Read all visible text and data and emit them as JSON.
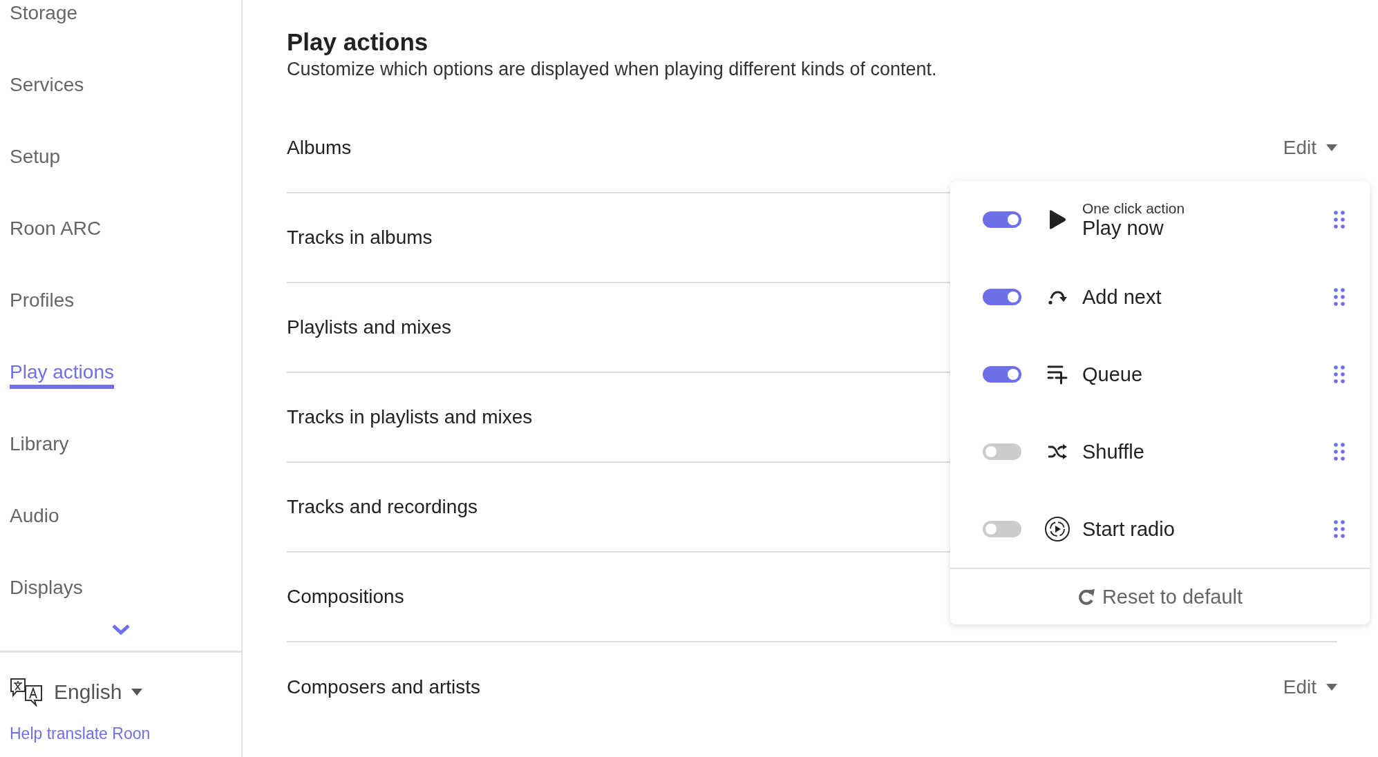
{
  "sidebar": {
    "items": [
      {
        "label": "Storage",
        "selected": false
      },
      {
        "label": "Services",
        "selected": false
      },
      {
        "label": "Setup",
        "selected": false
      },
      {
        "label": "Roon ARC",
        "selected": false
      },
      {
        "label": "Profiles",
        "selected": false
      },
      {
        "label": "Play actions",
        "selected": true
      },
      {
        "label": "Library",
        "selected": false
      },
      {
        "label": "Audio",
        "selected": false
      },
      {
        "label": "Displays",
        "selected": false
      }
    ],
    "language": "English",
    "help_link": "Help translate Roon"
  },
  "main": {
    "title": "Play actions",
    "subtitle": "Customize which options are displayed when playing different kinds of content.",
    "rows": [
      {
        "label": "Albums",
        "edit": "Edit"
      },
      {
        "label": "Tracks in albums"
      },
      {
        "label": "Playlists and mixes"
      },
      {
        "label": "Tracks in playlists and mixes"
      },
      {
        "label": "Tracks and recordings"
      },
      {
        "label": "Compositions"
      },
      {
        "label": "Composers and artists",
        "edit": "Edit"
      }
    ]
  },
  "popup": {
    "actions": [
      {
        "kind": "play",
        "caption": "One click action",
        "label": "Play now",
        "on": true
      },
      {
        "kind": "add_next",
        "label": "Add next",
        "on": true
      },
      {
        "kind": "queue",
        "label": "Queue",
        "on": true
      },
      {
        "kind": "shuffle",
        "label": "Shuffle",
        "on": false
      },
      {
        "kind": "radio",
        "label": "Start radio",
        "on": false
      }
    ],
    "reset": "Reset to default"
  }
}
